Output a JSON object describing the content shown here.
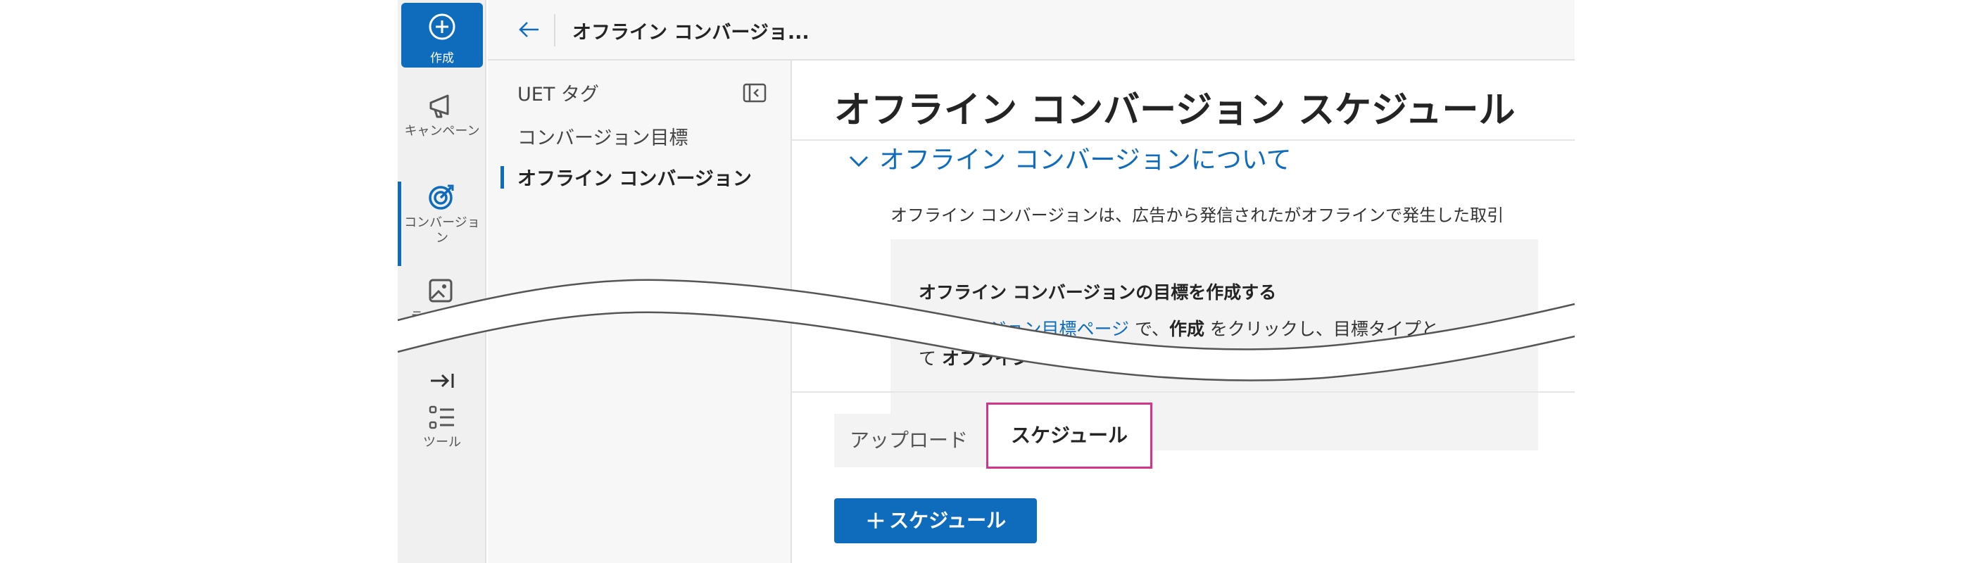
{
  "rail": {
    "create_label": "作成",
    "items": [
      {
        "label": "キャンペーン",
        "icon": "megaphone-icon"
      },
      {
        "label": "コンバージョン",
        "icon": "target-icon"
      },
      {
        "label": "ライブラリ",
        "icon": "image-library-icon"
      },
      {
        "label": "ツール",
        "icon": "tools-list-icon"
      }
    ],
    "expand_icon": "expand-arrow-icon"
  },
  "topbar": {
    "breadcrumb": "オフライン コンバージョ..."
  },
  "subnav": {
    "items": [
      {
        "label": "UET タグ"
      },
      {
        "label": "コンバージョン目標"
      },
      {
        "label": "オフライン コンバージョン",
        "active": true
      }
    ]
  },
  "main": {
    "title": "オフライン コンバージョン スケジュール",
    "about_toggle": "オフライン コンバージョンについて",
    "intro": "オフライン コンバージョンは、広告から発信されたがオフラインで発生した取引",
    "info_box": {
      "heading": "オフライン コンバージョンの目標を作成する",
      "line1_link": "コンバージョン目標ページ",
      "line1_text_a": " で、",
      "line1_bold": "作成",
      "line1_text_b": " をクリックし、目標タイプと",
      "line2_prefix": "て ",
      "line2_bold": "オフライン コンバージョン"
    },
    "tabs": {
      "upload": "アップロード",
      "schedule": "スケジュール"
    },
    "add_button": "スケジュール"
  },
  "colors": {
    "accent": "#0f6cbd",
    "highlight": "#d6338a"
  }
}
